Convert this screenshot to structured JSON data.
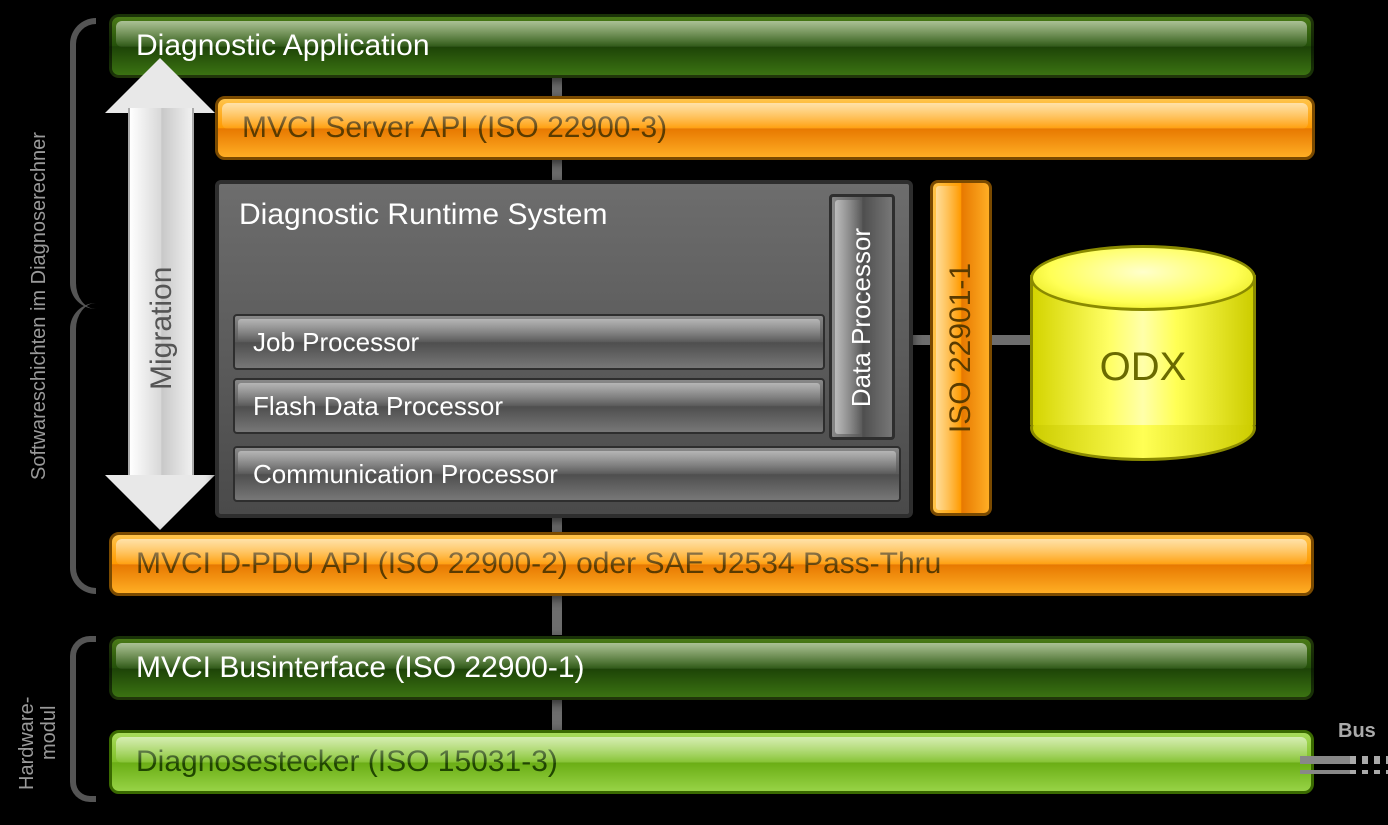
{
  "sideLabels": {
    "software": "Softwareschichten im Diagnoserechner",
    "hardware": "Hardware-\nmodul"
  },
  "migration": "Migration",
  "layers": {
    "app": "Diagnostic Application",
    "serverApi": "MVCI Server API (ISO 22900-3)",
    "pduApi": "MVCI D-PDU API (ISO 22900-2) oder SAE J2534 Pass-Thru",
    "businterface": "MVCI Businterface (ISO 22900-1)",
    "stecker": "Diagnosestecker (ISO 15031-3)"
  },
  "runtime": {
    "title": "Diagnostic Runtime System",
    "job": "Job Processor",
    "flash": "Flash Data Processor",
    "comm": "Communication Processor",
    "dataProc": "Data Processor"
  },
  "iso": "ISO 22901-1",
  "odx": "ODX",
  "bus": "Bus"
}
